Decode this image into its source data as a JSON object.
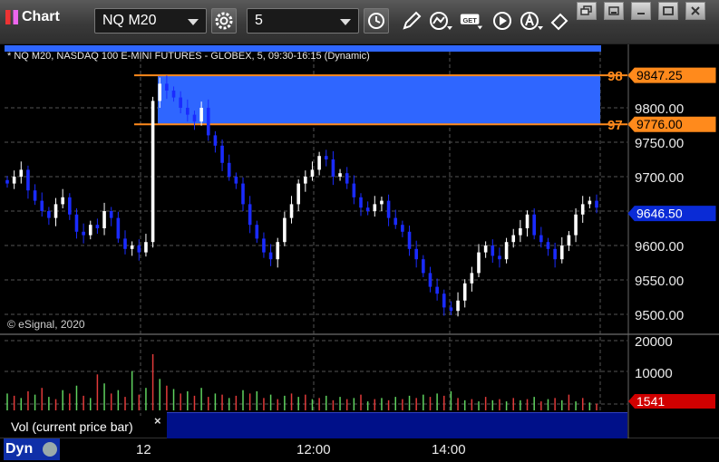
{
  "window": {
    "title": "Chart"
  },
  "toolbar": {
    "symbol": "NQ M20",
    "interval": "5",
    "icons": [
      "settings-icon",
      "clock-icon",
      "draw-pencil-icon",
      "chart-style-icon",
      "get-data-icon",
      "play-icon",
      "alert-icon",
      "eraser-icon"
    ],
    "window_buttons": [
      "restore",
      "minimize",
      "maximize",
      "close"
    ]
  },
  "chart": {
    "symbol_line": "* NQ M20, NASDAQ 100 E-MINI FUTURES - GLOBEX, 5, 09:30-16:15 (Dynamic)",
    "copyright": "© eSignal, 2020",
    "y_ticks": [
      "9800.00",
      "9750.00",
      "9700.00",
      "9650.00",
      "9600.00",
      "9550.00",
      "9500.00"
    ],
    "level_upper": {
      "tag": "98",
      "price": "9847.25"
    },
    "level_lower": {
      "tag": "97",
      "price": "9776.00"
    },
    "last_price": "9646.50",
    "x_ticks": [
      "12",
      "12:00",
      "14:00"
    ],
    "colors": {
      "up": "#ffffff",
      "down": "#1a2bff",
      "zone": "#2f66ff",
      "level": "#ff8a1c",
      "last_price_bg": "#0a2bd6",
      "vol_up": "#5fd35f",
      "vol_down": "#e23a3a"
    }
  },
  "volume": {
    "label": "Vol (current price bar)",
    "close_symbol": "×",
    "y_ticks": [
      "20000",
      "10000"
    ],
    "last_value": "1541"
  },
  "footer": {
    "mode": "Dyn"
  }
}
